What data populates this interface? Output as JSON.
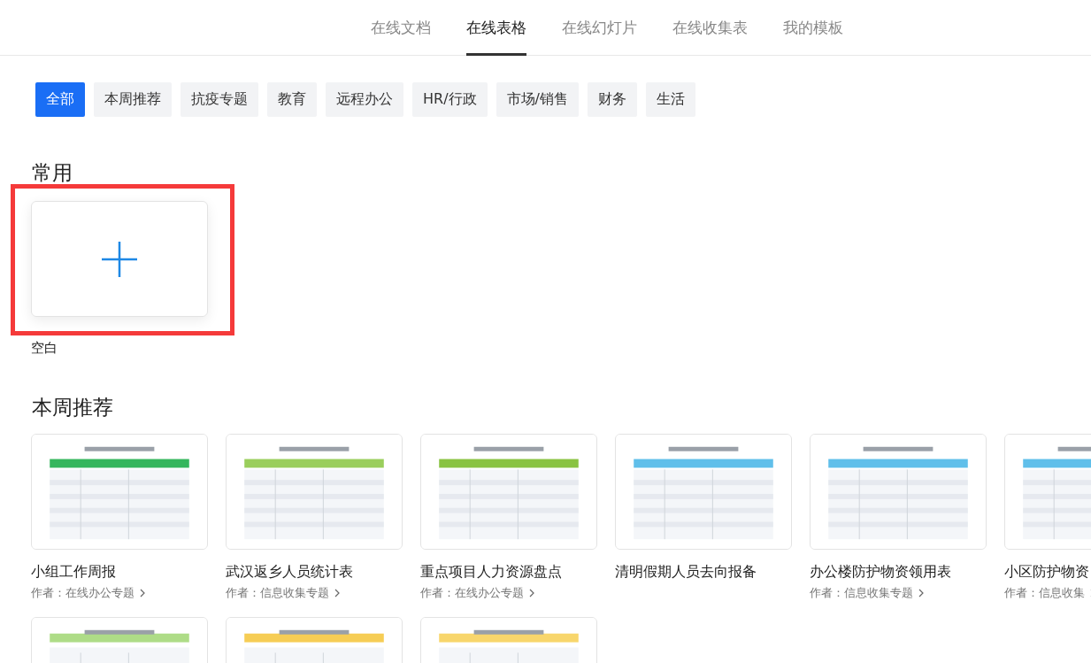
{
  "nav_tabs": [
    {
      "label": "在线文档",
      "selected": false
    },
    {
      "label": "在线表格",
      "selected": true
    },
    {
      "label": "在线幻灯片",
      "selected": false
    },
    {
      "label": "在线收集表",
      "selected": false
    },
    {
      "label": "我的模板",
      "selected": false
    }
  ],
  "categories": [
    {
      "label": "全部",
      "selected": true
    },
    {
      "label": "本周推荐",
      "selected": false
    },
    {
      "label": "抗疫专题",
      "selected": false
    },
    {
      "label": "教育",
      "selected": false
    },
    {
      "label": "远程办公",
      "selected": false
    },
    {
      "label": "HR/行政",
      "selected": false
    },
    {
      "label": "市场/销售",
      "selected": false
    },
    {
      "label": "财务",
      "selected": false
    },
    {
      "label": "生活",
      "selected": false
    }
  ],
  "common": {
    "heading": "常用",
    "blank_label": "空白",
    "highlighted": true
  },
  "weekly": {
    "heading": "本周推荐",
    "templates": [
      {
        "title": "小组工作周报",
        "author": "作者：在线办公专题"
      },
      {
        "title": "武汉返乡人员统计表",
        "author": "作者：信息收集专题"
      },
      {
        "title": "重点项目人力资源盘点",
        "author": "作者：在线办公专题"
      },
      {
        "title": "清明假期人员去向报备"
      },
      {
        "title": "办公楼防护物资领用表",
        "author": "作者：信息收集专题"
      },
      {
        "title": "小区防护物资",
        "author": "作者：信息收集"
      },
      {
        "kind": "picture"
      },
      {
        "kind": "picture"
      },
      {
        "kind": "picture"
      }
    ]
  }
}
